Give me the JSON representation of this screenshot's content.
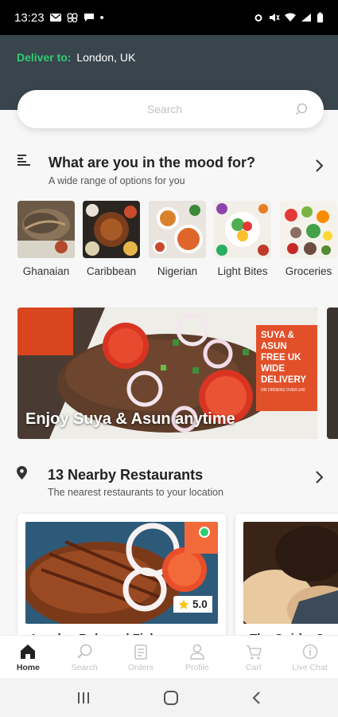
{
  "status_bar": {
    "time": "13:23",
    "dot": "•"
  },
  "header": {
    "deliver_label": "Deliver to:",
    "deliver_value": "London, UK"
  },
  "search": {
    "placeholder": "Search"
  },
  "mood_section": {
    "title": "What are you in the mood for?",
    "subtitle": "A wide range of options for you",
    "categories": [
      {
        "label": "Ghanaian"
      },
      {
        "label": "Caribbean"
      },
      {
        "label": "Nigerian"
      },
      {
        "label": "Light Bites"
      },
      {
        "label": "Groceries"
      }
    ]
  },
  "banner": {
    "caption": "Enjoy Suya & Asun anytime",
    "promo_lines": [
      "SUYA &",
      "ASUN",
      "FREE UK",
      "WIDE",
      "DELIVERY"
    ],
    "promo_small": "ON ORDERS OVER £40"
  },
  "nearby_section": {
    "title": "13 Nearby Restaurants",
    "subtitle": "The nearest restaurants to your location",
    "restaurants": [
      {
        "name": "London Bole and Fish",
        "rating": "5.0"
      },
      {
        "name": "The Quirky Q"
      }
    ]
  },
  "bottom_nav": {
    "items": [
      {
        "label": "Home",
        "icon": "home-icon",
        "active": true
      },
      {
        "label": "Search",
        "icon": "search-icon"
      },
      {
        "label": "Orders",
        "icon": "orders-icon"
      },
      {
        "label": "Profile",
        "icon": "profile-icon"
      },
      {
        "label": "Cart",
        "icon": "cart-icon"
      },
      {
        "label": "Live Chat",
        "icon": "chat-icon"
      }
    ]
  },
  "colors": {
    "accent": "#2ecc71",
    "header_bg": "#39454d",
    "promo": "#e2502a",
    "star": "#f5c518"
  }
}
